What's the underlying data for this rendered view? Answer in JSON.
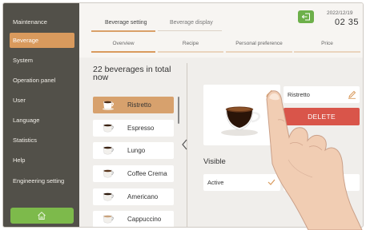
{
  "sidebar": {
    "items": [
      {
        "label": "Maintenance"
      },
      {
        "label": "Beverage"
      },
      {
        "label": "System"
      },
      {
        "label": "Operation panel"
      },
      {
        "label": "User"
      },
      {
        "label": "Language"
      },
      {
        "label": "Statistics"
      },
      {
        "label": "Help"
      },
      {
        "label": "Engineering setting"
      }
    ],
    "active": "Beverage"
  },
  "header": {
    "tabs": [
      {
        "label": "Beverage setting"
      },
      {
        "label": "Beverage display"
      }
    ],
    "date": "2022/12/19",
    "time": "02 35",
    "subtabs": [
      {
        "label": "Overview"
      },
      {
        "label": "Recipe"
      },
      {
        "label": "Personal preference"
      },
      {
        "label": "Price"
      }
    ]
  },
  "list": {
    "title": "22 beverages in total now",
    "items": [
      {
        "label": "Ristretto"
      },
      {
        "label": "Espresso"
      },
      {
        "label": "Lungo"
      },
      {
        "label": "Coffee Crema"
      },
      {
        "label": "Americano"
      },
      {
        "label": "Cappuccino"
      }
    ],
    "selected": "Ristretto"
  },
  "detail": {
    "name_value": "Ristretto",
    "delete_label": "DELETE",
    "visible_label": "Visible",
    "visible_value": "Active"
  },
  "colors": {
    "sidebar_bg": "#525049",
    "accent": "#d99a5d",
    "delete": "#d9554a",
    "green": "#6db04a"
  },
  "icons": [
    "home-icon",
    "back-icon",
    "pencil-icon",
    "check-icon",
    "chevron-left-icon",
    "cup-icon"
  ]
}
